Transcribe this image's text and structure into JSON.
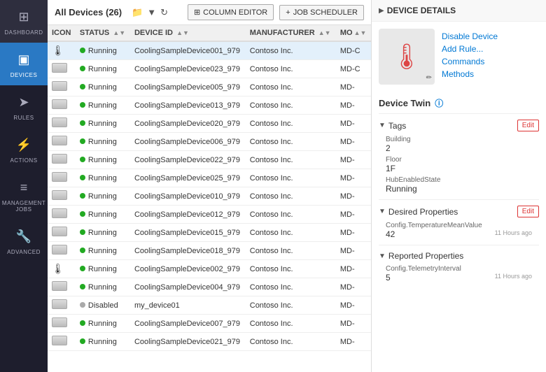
{
  "sidebar": {
    "items": [
      {
        "id": "dashboard",
        "label": "Dashboard",
        "icon": "⊞",
        "active": false
      },
      {
        "id": "devices",
        "label": "Devices",
        "icon": "▣",
        "active": true
      },
      {
        "id": "rules",
        "label": "Rules",
        "icon": "➤",
        "active": false
      },
      {
        "id": "actions",
        "label": "Actions",
        "icon": "⚡",
        "active": false
      },
      {
        "id": "management-jobs",
        "label": "Management Jobs",
        "icon": "≡",
        "active": false
      },
      {
        "id": "advanced",
        "label": "Advanced",
        "icon": "🔧",
        "active": false
      }
    ]
  },
  "topbar": {
    "title": "All Devices (26)",
    "column_editor_label": "COLUMN EDITOR",
    "job_scheduler_label": "JOB SCHEDULER"
  },
  "table": {
    "columns": [
      {
        "id": "icon",
        "label": "ICON"
      },
      {
        "id": "status",
        "label": "STATUS"
      },
      {
        "id": "device_id",
        "label": "DEVICE ID"
      },
      {
        "id": "manufacturer",
        "label": "MANUFACTURER"
      },
      {
        "id": "model",
        "label": "MO"
      }
    ],
    "rows": [
      {
        "icon": "therm",
        "status": "Running",
        "status_type": "green",
        "device_id": "CoolingSampleDevice001_979",
        "manufacturer": "Contoso Inc.",
        "model": "MD-C",
        "selected": true
      },
      {
        "icon": "server",
        "status": "Running",
        "status_type": "green",
        "device_id": "CoolingSampleDevice023_979",
        "manufacturer": "Contoso Inc.",
        "model": "MD-C",
        "selected": false
      },
      {
        "icon": "server",
        "status": "Running",
        "status_type": "green",
        "device_id": "CoolingSampleDevice005_979",
        "manufacturer": "Contoso Inc.",
        "model": "MD-",
        "selected": false
      },
      {
        "icon": "server",
        "status": "Running",
        "status_type": "green",
        "device_id": "CoolingSampleDevice013_979",
        "manufacturer": "Contoso Inc.",
        "model": "MD-",
        "selected": false
      },
      {
        "icon": "server",
        "status": "Running",
        "status_type": "green",
        "device_id": "CoolingSampleDevice020_979",
        "manufacturer": "Contoso Inc.",
        "model": "MD-",
        "selected": false
      },
      {
        "icon": "server",
        "status": "Running",
        "status_type": "green",
        "device_id": "CoolingSampleDevice006_979",
        "manufacturer": "Contoso Inc.",
        "model": "MD-",
        "selected": false
      },
      {
        "icon": "server",
        "status": "Running",
        "status_type": "green",
        "device_id": "CoolingSampleDevice022_979",
        "manufacturer": "Contoso Inc.",
        "model": "MD-",
        "selected": false
      },
      {
        "icon": "server",
        "status": "Running",
        "status_type": "green",
        "device_id": "CoolingSampleDevice025_979",
        "manufacturer": "Contoso Inc.",
        "model": "MD-",
        "selected": false
      },
      {
        "icon": "server",
        "status": "Running",
        "status_type": "green",
        "device_id": "CoolingSampleDevice010_979",
        "manufacturer": "Contoso Inc.",
        "model": "MD-",
        "selected": false
      },
      {
        "icon": "server",
        "status": "Running",
        "status_type": "green",
        "device_id": "CoolingSampleDevice012_979",
        "manufacturer": "Contoso Inc.",
        "model": "MD-",
        "selected": false
      },
      {
        "icon": "server",
        "status": "Running",
        "status_type": "green",
        "device_id": "CoolingSampleDevice015_979",
        "manufacturer": "Contoso Inc.",
        "model": "MD-",
        "selected": false
      },
      {
        "icon": "server",
        "status": "Running",
        "status_type": "green",
        "device_id": "CoolingSampleDevice018_979",
        "manufacturer": "Contoso Inc.",
        "model": "MD-",
        "selected": false
      },
      {
        "icon": "therm",
        "status": "Running",
        "status_type": "green",
        "device_id": "CoolingSampleDevice002_979",
        "manufacturer": "Contoso Inc.",
        "model": "MD-",
        "selected": false
      },
      {
        "icon": "server",
        "status": "Running",
        "status_type": "green",
        "device_id": "CoolingSampleDevice004_979",
        "manufacturer": "Contoso Inc.",
        "model": "MD-",
        "selected": false
      },
      {
        "icon": "server",
        "status": "Disabled",
        "status_type": "gray",
        "device_id": "my_device01",
        "manufacturer": "Contoso Inc.",
        "model": "MD-",
        "selected": false
      },
      {
        "icon": "server",
        "status": "Running",
        "status_type": "green",
        "device_id": "CoolingSampleDevice007_979",
        "manufacturer": "Contoso Inc.",
        "model": "MD-",
        "selected": false
      },
      {
        "icon": "server",
        "status": "Running",
        "status_type": "green",
        "device_id": "CoolingSampleDevice021_979",
        "manufacturer": "Contoso Inc.",
        "model": "MD-",
        "selected": false
      }
    ]
  },
  "panel": {
    "header": "DEVICE DETAILS",
    "links": [
      {
        "id": "disable-device",
        "label": "Disable Device"
      },
      {
        "id": "add-rule",
        "label": "Add Rule..."
      },
      {
        "id": "commands",
        "label": "Commands"
      },
      {
        "id": "methods",
        "label": "Methods"
      }
    ],
    "twin": {
      "title": "Device Twin",
      "tags_label": "Tags",
      "tags_edit": "Edit",
      "building_label": "Building",
      "building_value": "2",
      "floor_label": "Floor",
      "floor_value": "1F",
      "hub_state_label": "HubEnabledState",
      "hub_state_value": "Running",
      "desired_label": "Desired Properties",
      "desired_edit": "Edit",
      "config_temp_label": "Config.TemperatureMeanValue",
      "config_temp_value": "42",
      "config_temp_time": "11 Hours ago",
      "reported_label": "Reported Properties",
      "config_telemetry_label": "Config.TelemetryInterval",
      "config_telemetry_value": "5",
      "config_telemetry_time": "11 Hours ago"
    }
  }
}
